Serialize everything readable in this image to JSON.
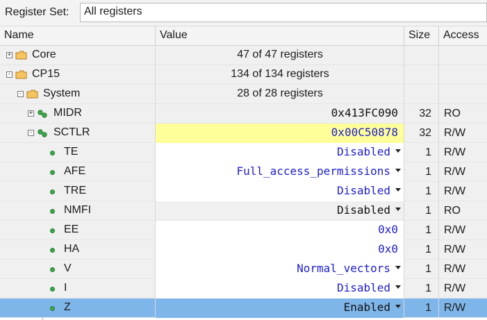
{
  "topbar": {
    "label": "Register Set:",
    "value": "All registers"
  },
  "columns": {
    "name": "Name",
    "value": "Value",
    "size": "Size",
    "access": "Access"
  },
  "rows": [
    {
      "name": "Core",
      "value": "47 of 47 registers",
      "size": "",
      "access": "",
      "icon": "folder-icon",
      "expander": "+"
    },
    {
      "name": "CP15",
      "value": "134 of 134 registers",
      "size": "",
      "access": "",
      "icon": "folder-icon",
      "expander": "-"
    },
    {
      "name": "System",
      "value": "28 of 28 registers",
      "size": "",
      "access": "",
      "icon": "folder-icon",
      "expander": "-"
    },
    {
      "name": "MIDR",
      "value": "0x413FC090",
      "size": "32",
      "access": "RO",
      "icon": "register-icon",
      "expander": "+"
    },
    {
      "name": "SCTLR",
      "value": "0x00C50878",
      "size": "32",
      "access": "R/W",
      "icon": "register-icon",
      "expander": "-"
    },
    {
      "name": "TE",
      "value": "Disabled",
      "size": "1",
      "access": "R/W",
      "icon": "field-icon"
    },
    {
      "name": "AFE",
      "value": "Full_access_permissions",
      "size": "1",
      "access": "R/W",
      "icon": "field-icon"
    },
    {
      "name": "TRE",
      "value": "Disabled",
      "size": "1",
      "access": "R/W",
      "icon": "field-icon"
    },
    {
      "name": "NMFI",
      "value": "Disabled",
      "size": "1",
      "access": "RO",
      "icon": "field-icon"
    },
    {
      "name": "EE",
      "value": "0x0",
      "size": "1",
      "access": "R/W",
      "icon": "field-icon"
    },
    {
      "name": "HA",
      "value": "0x0",
      "size": "1",
      "access": "R/W",
      "icon": "field-icon"
    },
    {
      "name": "V",
      "value": "Normal_vectors",
      "size": "1",
      "access": "R/W",
      "icon": "field-icon"
    },
    {
      "name": "I",
      "value": "Disabled",
      "size": "1",
      "access": "R/W",
      "icon": "field-icon"
    },
    {
      "name": "Z",
      "value": "Enabled",
      "size": "1",
      "access": "R/W",
      "icon": "field-icon"
    }
  ],
  "colors": {
    "highlight": "#ffff99",
    "selection": "#7fb6ea",
    "value_blue": "#1c1ccf",
    "icon_green": "#3ba84a",
    "folder_orange": "#e8a23a"
  }
}
